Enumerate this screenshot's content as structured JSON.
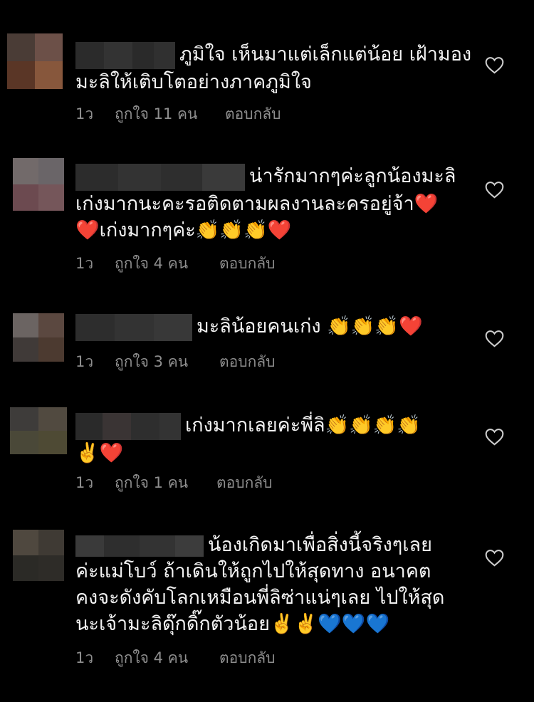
{
  "colors": {
    "background": "#000000",
    "text": "#f2f2f2",
    "meta": "#8e8e8e"
  },
  "comments": [
    {
      "text": "ภูมิใจ เห็นมาแต่เล็กแต่น้อย เฝ้ามองมะลิให้เติบโตอย่างภาคภูมิใจ",
      "time": "1ว",
      "likes": "ถูกใจ 11 คน",
      "reply": "ตอบกลับ"
    },
    {
      "text": "น่ารักมากๆค่ะลูกน้องมะลิ เก่งมากนะคะรอติดตามผลงานละครอยู่จ้า❤️ ❤️เก่งมากๆค่ะ👏👏👏❤️",
      "time": "1ว",
      "likes": "ถูกใจ 4 คน",
      "reply": "ตอบกลับ"
    },
    {
      "text": "มะลิน้อยคนเก่ง 👏👏👏❤️",
      "time": "1ว",
      "likes": "ถูกใจ 3 คน",
      "reply": "ตอบกลับ"
    },
    {
      "text": "เก่งมากเลยค่ะพี่ลิ👏👏👏👏 ✌️❤️",
      "time": "1ว",
      "likes": "ถูกใจ 1 คน",
      "reply": "ตอบกลับ"
    },
    {
      "text": "น้องเกิดมาเพื่อสิ่งนี้จริงๆเลย ค่ะแม่โบว์ ถ้าเดินให้ถูกไปให้สุดทาง อนาคตคงจะดังคับโลกเหมือนพี่ลิซ่าแน่ๆเลย ไปให้สุดนะเจ้ามะลิดุ๊กดิ๊กตัวน้อย✌️✌️💙💙💙",
      "time": "1ว",
      "likes": "ถูกใจ 4 คน",
      "reply": "ตอบกลับ"
    }
  ]
}
